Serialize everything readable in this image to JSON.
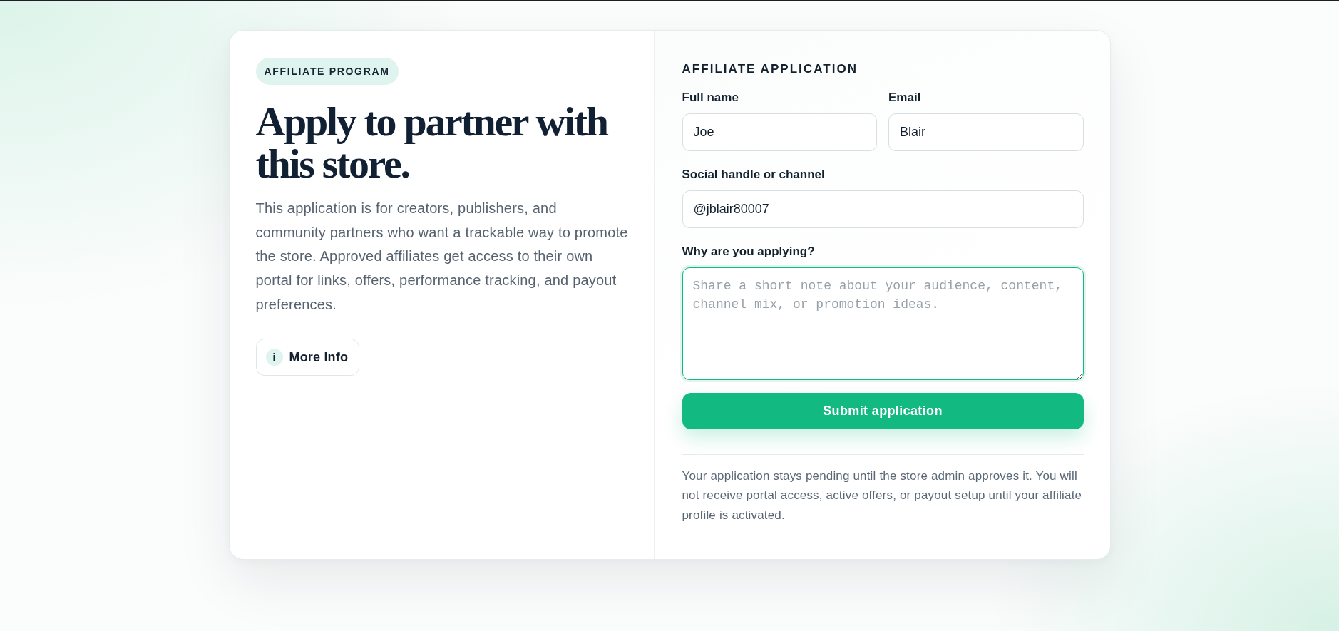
{
  "badge": {
    "label": "AFFILIATE PROGRAM"
  },
  "heading": "Apply to partner with this store.",
  "intro": "This application is for creators, publishers, and community partners who want a trackable way to promote the store. Approved affiliates get access to their own portal for links, offers, performance tracking, and payout preferences.",
  "more_info_button": {
    "icon": "i",
    "label": "More info"
  },
  "form": {
    "title": "AFFILIATE APPLICATION",
    "rows": [
      {
        "fields": [
          {
            "kind": "text",
            "label": "Full name",
            "value": "Joe"
          },
          {
            "kind": "text",
            "label": "Email",
            "value": "Blair"
          }
        ]
      },
      {
        "fields": [
          {
            "kind": "text",
            "label": "Social handle or channel",
            "value": "@jblair80007"
          }
        ]
      },
      {
        "fields": [
          {
            "kind": "textarea",
            "label": "Why are you applying?",
            "placeholder": "Share a short note about your audience, content, channel mix, or promotion ideas.",
            "focused": true
          }
        ]
      }
    ],
    "submit_button": "Submit application",
    "note": "Your application stays pending until the store admin approves it. You will not receive portal access, active offers, or payout setup until your affiliate profile is activated."
  }
}
